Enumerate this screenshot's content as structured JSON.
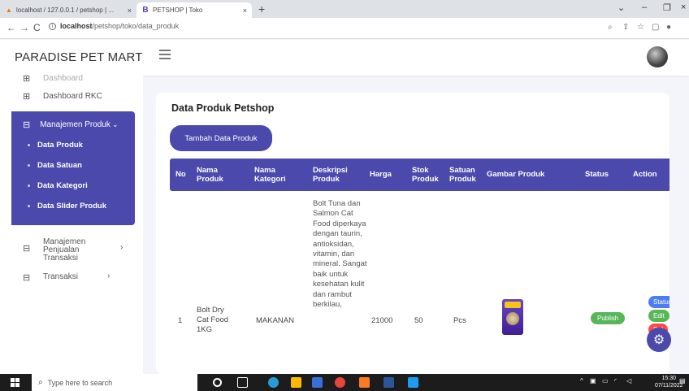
{
  "browser": {
    "tabs": [
      {
        "label": "localhost / 127.0.0.1 / petshop | ...",
        "close": "×",
        "icon": "xampp-icon"
      },
      {
        "label": "PETSHOP | Toko",
        "close": "×",
        "icon": "bootstrap-icon"
      }
    ],
    "new_tab": "+",
    "url_host": "localhost",
    "url_path": "/petshop/toko/data_produk"
  },
  "app": {
    "brand": "PARADISE PET MART",
    "accent_color": "#4b49ac"
  },
  "sidebar": {
    "cut_item": "Dashboard",
    "items": [
      {
        "label": "Dashboard RKC",
        "icon": "grid-icon"
      },
      {
        "label": "Manajemen Produk",
        "icon": "table-icon",
        "expanded": true
      },
      {
        "label": "Manajemen Penjualan Transaksi",
        "icon": "table-icon"
      },
      {
        "label": "Transaksi",
        "icon": "table-icon"
      }
    ],
    "subitems": [
      "Data Produk",
      "Data Satuan",
      "Data Kategori",
      "Data Slider Produk"
    ]
  },
  "main": {
    "title": "Data Produk Petshop",
    "add_button": "Tambah Data Produk",
    "columns": [
      "No",
      "Nama Produk",
      "Nama Kategori",
      "Deskripsi Produk",
      "Harga",
      "Stok Produk",
      "Satuan Produk",
      "Gambar Produk",
      "Status",
      "Action"
    ],
    "rows": [
      {
        "no": "1",
        "nama_produk": "Bolt Dry Cat Food 1KG",
        "kategori": "MAKANAN",
        "deskripsi": "Bolt Tuna dan Salmon Cat Food diperkaya dengan taurin, antioksidan, vitamin, dan mineral. Sangat baik untuk kesehatan kulit dan rambut berkilau,",
        "harga": "21000",
        "stok": "50",
        "satuan": "Pcs",
        "status": "Publish",
        "actions": [
          "Status",
          "Edit",
          "Del"
        ]
      }
    ]
  },
  "taskbar": {
    "search_placeholder": "Type here to search",
    "time": "15:30",
    "date": "07/11/2022"
  }
}
